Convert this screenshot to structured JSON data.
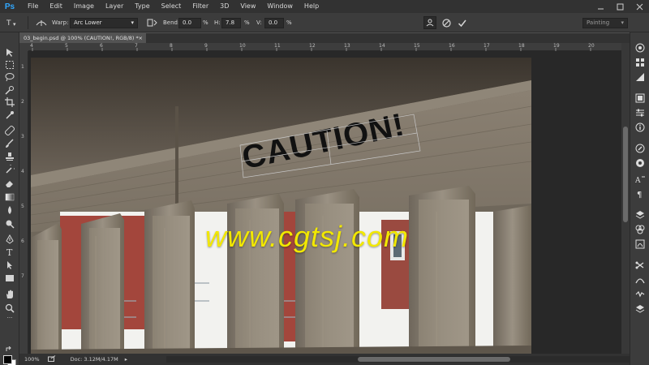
{
  "app": {
    "logo": "Ps",
    "menu": [
      "File",
      "Edit",
      "Image",
      "Layer",
      "Type",
      "Select",
      "Filter",
      "3D",
      "View",
      "Window",
      "Help"
    ]
  },
  "window_controls": [
    "minimize-icon",
    "maximize-icon",
    "close-icon"
  ],
  "options": {
    "warp_label": "Warp:",
    "warp_style": "Arc Lower",
    "bend_label": "Bend:",
    "bend_value": "0.0",
    "h_label": "H:",
    "h_value": "7.8",
    "v_label": "V:",
    "v_value": "0.0",
    "percent": "%",
    "workspace": "Painting"
  },
  "document": {
    "tab_title": "03_begin.psd @ 100% (CAUTION!, RGB/8) *",
    "close": "×"
  },
  "ruler": {
    "top_labels": [
      "4",
      "5",
      "6",
      "7",
      "8",
      "9",
      "10",
      "11",
      "12",
      "13",
      "14",
      "15",
      "16",
      "17",
      "18",
      "19",
      "20"
    ],
    "left_labels": [
      "1",
      "2",
      "3",
      "4",
      "5",
      "6",
      "7"
    ]
  },
  "canvas": {
    "text": "CAUTION!"
  },
  "watermark": "www.cgtsj.com",
  "status": {
    "zoom": "100%",
    "doc": "Doc: 3.12M/4.17M"
  },
  "tools": [
    "move-icon",
    "marquee-icon",
    "lasso-icon",
    "quick-select-icon",
    "crop-icon",
    "eyedropper-icon",
    "healing-brush-icon",
    "brush-icon",
    "clone-stamp-icon",
    "history-brush-icon",
    "eraser-icon",
    "gradient-icon",
    "blur-icon",
    "dodge-icon",
    "pen-icon",
    "type-icon",
    "path-select-icon",
    "rectangle-icon",
    "hand-icon",
    "zoom-icon"
  ],
  "right_icons": [
    "color-icon",
    "swatches-icon",
    "adjustments-icon",
    "styles-icon",
    "properties-icon",
    "info-icon",
    "brush-presets-icon",
    "clone-source-icon",
    "character-icon",
    "paragraph-icon",
    "layers-icon",
    "channels-icon",
    "paths-icon",
    "history-icon",
    "actions-icon"
  ],
  "colors": {
    "accent": "#31a8ff",
    "watermark": "#f2e800",
    "fg_swatch": "#000000",
    "bg_swatch": "#ffffff"
  }
}
